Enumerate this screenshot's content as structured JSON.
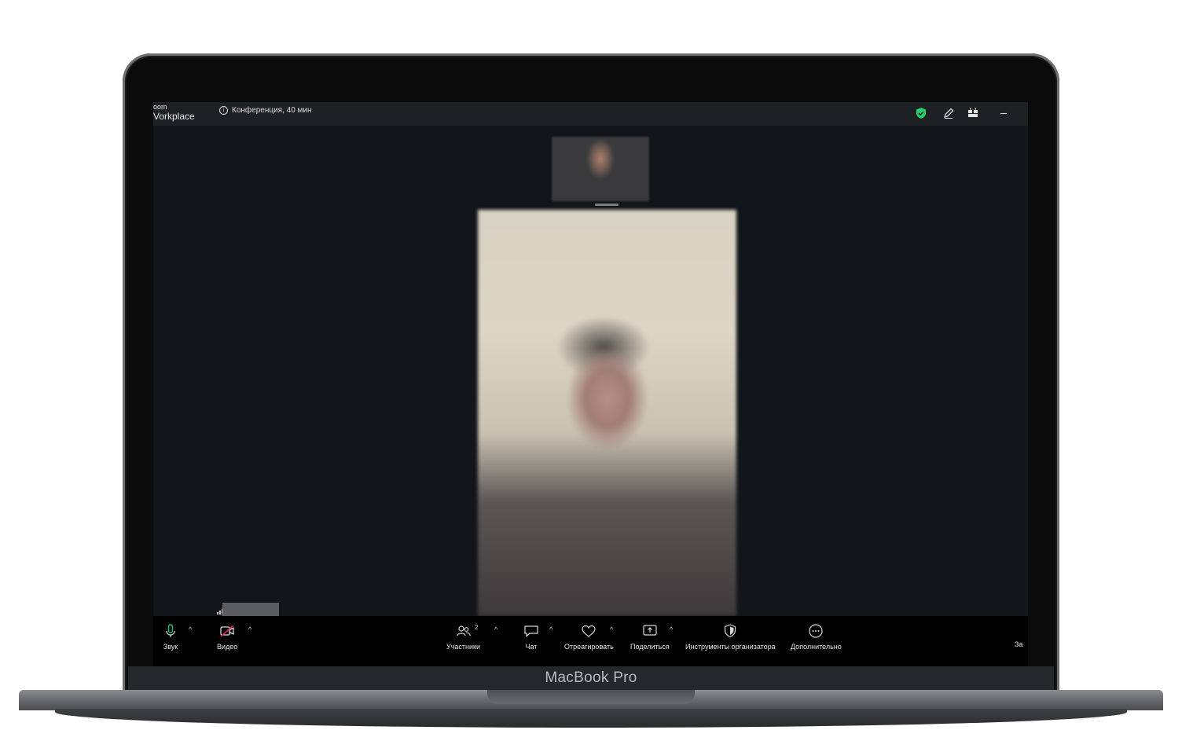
{
  "device": {
    "brand_label": "MacBook Pro"
  },
  "titlebar": {
    "app_name_line1": "oom",
    "app_name_line2": "Vorkplace",
    "meeting_info": "Конференция, 40 мин",
    "icons": [
      "shield-check-icon",
      "pen-icon",
      "gallery-grid-icon",
      "minimize-icon"
    ],
    "shield_color": "#2ecc71"
  },
  "toolbar": {
    "audio_label": "Звук",
    "video_label": "Видео",
    "participants_label": "Участники",
    "participants_count": "2",
    "chat_label": "Чат",
    "react_label": "Отреагировать",
    "share_label": "Поделиться",
    "host_tools_label": "Инструменты организатора",
    "more_label": "Дополнительно",
    "end_label_cut": "За",
    "caret_glyph": "^",
    "video_off_color": "#e0245e",
    "mic_color": "#22c37a"
  }
}
